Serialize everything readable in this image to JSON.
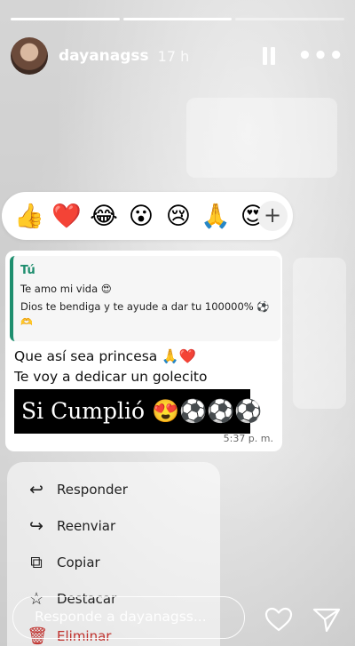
{
  "story": {
    "progress": [
      1.0,
      1.0,
      0.0
    ],
    "username": "dayanagss",
    "time_ago": "17 h",
    "icons": {
      "pause": "pause-icon",
      "more": "more-options-icon"
    }
  },
  "reactions": {
    "emojis": [
      "👍",
      "❤️",
      "😂",
      "😮",
      "😢",
      "🙏",
      "😍"
    ],
    "add_label": "+"
  },
  "message": {
    "quote": {
      "author": "Tú",
      "lines": [
        "Te amo mi vida 😍",
        "Dios te bendiga y te ayude a dar tu 100000% ⚽"
      ],
      "extra": "🫶"
    },
    "lines": [
      "Que así sea princesa 🙏❤️",
      "Te voy a dedicar un golecito"
    ],
    "sticker_text": "Si Cumplió 😍⚽⚽⚽",
    "time": "5:37 p. m."
  },
  "menu": {
    "items": [
      {
        "label": "Responder",
        "icon": "reply-icon"
      },
      {
        "label": "Reenviar",
        "icon": "forward-icon"
      },
      {
        "label": "Copiar",
        "icon": "copy-icon"
      },
      {
        "label": "Destacar",
        "icon": "star-icon"
      },
      {
        "label": "Eliminar",
        "icon": "trash-icon"
      }
    ]
  },
  "reply_bar": {
    "placeholder": "Responde a dayanagss...",
    "icons": {
      "like": "heart-icon",
      "send": "send-icon"
    }
  }
}
